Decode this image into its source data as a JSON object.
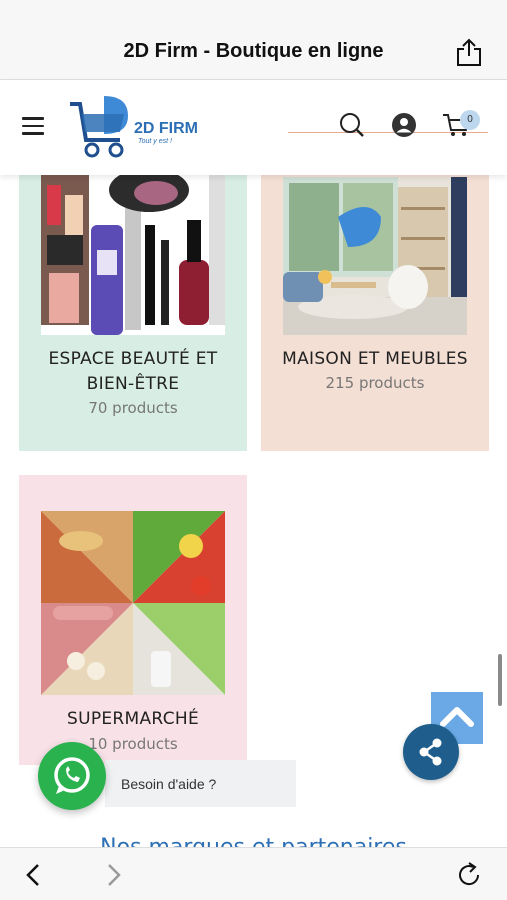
{
  "browser": {
    "title": "2D Firm - Boutique en ligne"
  },
  "header": {
    "logo_text": "2D FIRM",
    "logo_tagline": "Tout y est !",
    "cart_count": "0",
    "brand_color": "#2d6fb5"
  },
  "categories": [
    {
      "title": "ESPACE BEAUTÉ ET BIEN-ÊTRE",
      "count": "70 products",
      "bg": "#d8eee4"
    },
    {
      "title": "MAISON ET MEUBLES",
      "count": "215 products",
      "bg": "#f4dfd4"
    },
    {
      "title": "SUPERMARCHÉ",
      "count": "10 products",
      "bg": "#f8e2e8"
    }
  ],
  "partners_heading": "Nos marques et partenaires",
  "help": {
    "text": "Besoin d'aide ?"
  },
  "icons": [
    "share-icon",
    "menu-icon",
    "search-icon",
    "user-icon",
    "cart-icon",
    "arrow-up-icon",
    "share-fab-icon",
    "whatsapp-icon",
    "back-icon",
    "forward-icon",
    "reload-icon"
  ],
  "colors": {
    "whatsapp": "#2ab24f",
    "share_fab": "#1f5e8c",
    "scroll_top": "#6aa9e6"
  }
}
